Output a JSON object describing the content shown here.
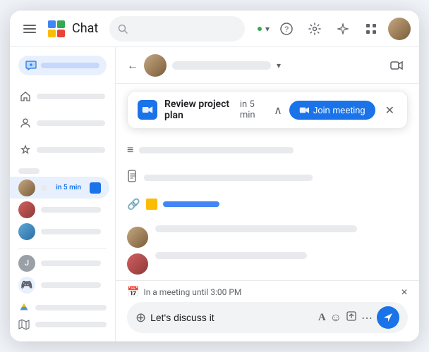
{
  "app": {
    "title": "Chat",
    "logo_text": "C"
  },
  "topbar": {
    "search_placeholder": "Search",
    "help_icon": "?",
    "settings_icon": "⚙",
    "ai_icon": "✦",
    "grid_icon": "⠿"
  },
  "sidebar": {
    "new_chat_label": "",
    "sections": [
      {
        "items": [
          {
            "type": "avatar1",
            "badge": ""
          },
          {
            "type": "avatar2",
            "badge": ""
          },
          {
            "type": "avatar3",
            "badge": ""
          }
        ]
      },
      {
        "items": [
          {
            "type": "active",
            "badge": "in 5 min"
          },
          {
            "type": "avatar2",
            "badge": ""
          },
          {
            "type": "avatar3",
            "badge": ""
          }
        ]
      },
      {
        "items": [
          {
            "type": "letter",
            "letter": "J"
          },
          {
            "type": "emoji",
            "emoji": "🎮"
          }
        ]
      }
    ],
    "drive_icon": "△"
  },
  "chat": {
    "header": {
      "back_icon": "←",
      "chevron": "▾",
      "video_icon": "🎥"
    },
    "meeting_banner": {
      "title": "Review project plan",
      "time": "in 5 min",
      "expand_icon": "∧",
      "join_btn": "Join meeting",
      "close_icon": "✕"
    },
    "messages": [
      {
        "type": "icon-row"
      },
      {
        "type": "icon-file"
      },
      {
        "type": "icon-attach"
      },
      {
        "type": "avatar1-msg"
      },
      {
        "type": "avatar2-msg"
      }
    ],
    "input": {
      "meeting_status": "In a meeting until 3:00 PM",
      "meeting_status_close": "✕",
      "placeholder": "Let's discuss it",
      "add_icon": "⊕",
      "format_icon": "A",
      "emoji_icon": "☺",
      "attach_icon": "⬆",
      "more_icon": "⋯",
      "send_icon": "➤"
    }
  }
}
